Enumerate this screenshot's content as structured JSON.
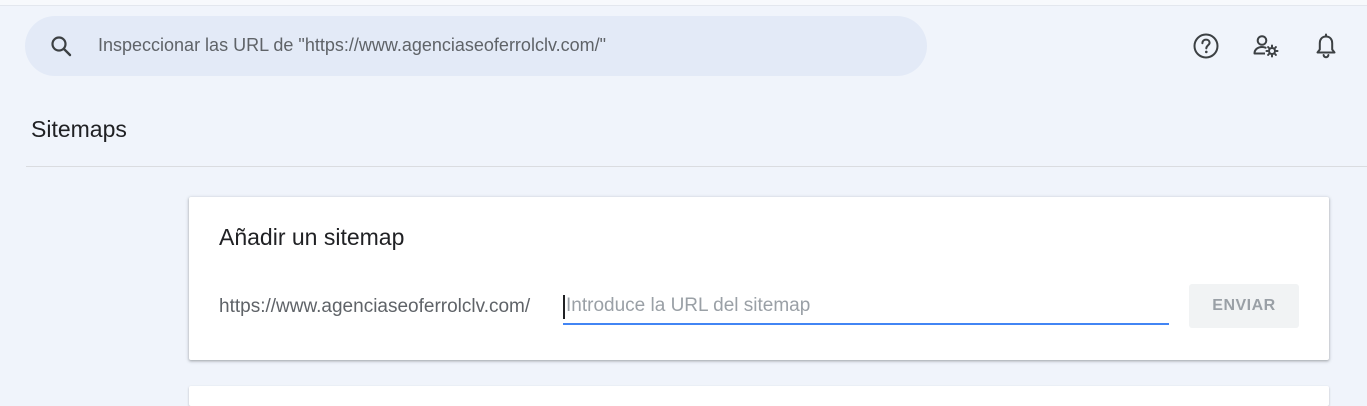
{
  "search": {
    "text": "Inspeccionar las URL de \"https://www.agenciaseoferrolclv.com/\"",
    "icon": "search-icon"
  },
  "header_icons": [
    "help-icon",
    "manage-users-icon",
    "notifications-icon"
  ],
  "page": {
    "title": "Sitemaps"
  },
  "add_sitemap": {
    "title": "Añadir un sitemap",
    "prefix": "https://www.agenciaseoferrolclv.com/",
    "input_value": "",
    "input_placeholder": "Introduce la URL del sitemap",
    "submit_label": "ENVIAR"
  },
  "colors": {
    "background": "#f0f4fb",
    "search_bg": "#e3eaf7",
    "accent": "#4285f4",
    "disabled_button_bg": "#f1f3f4",
    "disabled_button_text": "#9aa0a6"
  }
}
